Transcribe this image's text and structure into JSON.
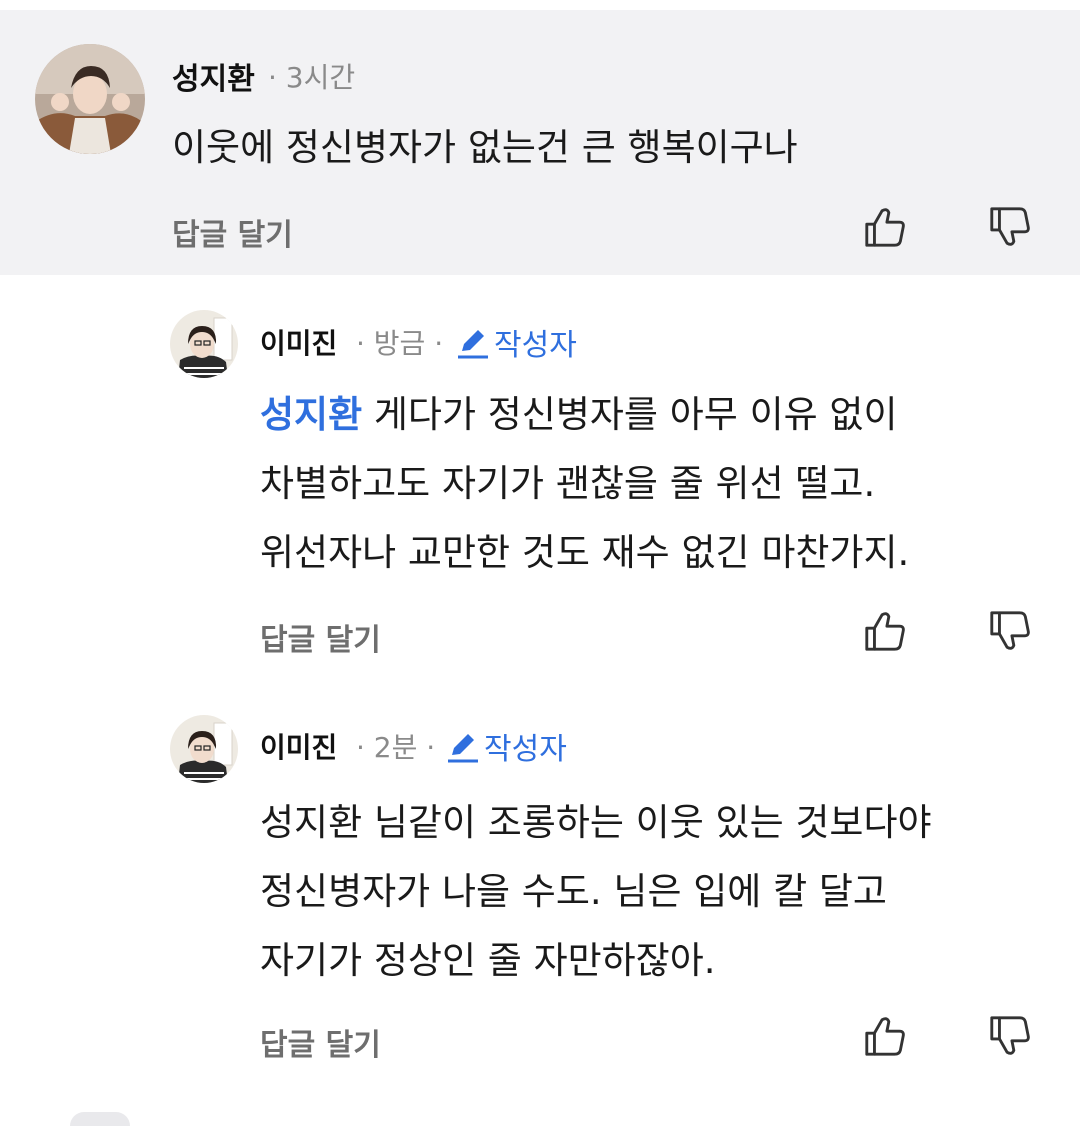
{
  "comments": [
    {
      "author": "성지환",
      "meta": "· 3시간",
      "text": "이웃에 정신병자가 없는건 큰 행복이구나",
      "reply_label": "답글 달기"
    },
    {
      "author": "이미진",
      "meta": "· 방금 ·",
      "author_tag": "작성자",
      "mention": "성지환",
      "lines": [
        "게다가 정신병자를 아무 이유 없이",
        "차별하고도 자기가 괜찮을 줄 위선 떨고.",
        "위선자나 교만한 것도 재수 없긴 마찬가지."
      ],
      "reply_label": "답글 달기"
    },
    {
      "author": "이미진",
      "meta": "· 2분 ·",
      "author_tag": "작성자",
      "lines": [
        "성지환 님같이 조롱하는 이웃 있는 것보다야",
        "정신병자가 나을 수도. 님은 입에 칼 달고",
        "자기가 정상인 줄 자만하잖아."
      ],
      "reply_label": "답글 달기"
    }
  ],
  "icons": {
    "like": "thumbs-up-icon",
    "dislike": "thumbs-down-icon",
    "author_tag": "pencil-icon"
  },
  "colors": {
    "parent_bg": "#f2f2f4",
    "accent": "#2f6fde",
    "meta": "#8a8a8a",
    "reply": "#6e6e6e"
  }
}
